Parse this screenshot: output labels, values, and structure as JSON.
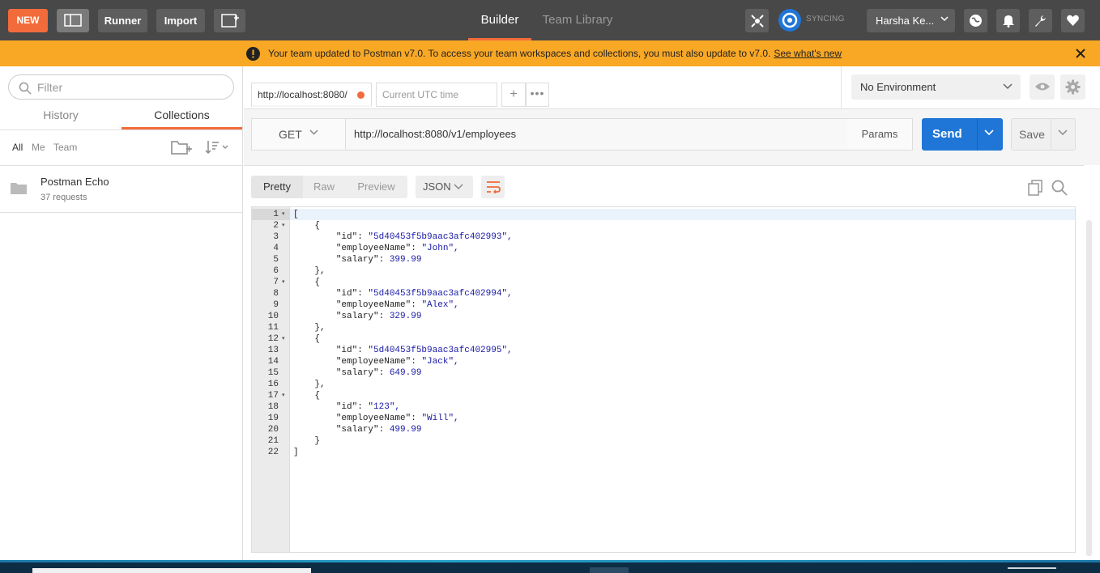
{
  "header": {
    "new_label": "NEW",
    "runner_label": "Runner",
    "import_label": "Import",
    "tab_builder": "Builder",
    "tab_team_library": "Team Library",
    "sync_status": "SYNCING",
    "user_name": "Harsha Ke...",
    "accent": "#f26b3a"
  },
  "banner": {
    "message": "Your team updated to Postman v7.0. To access your team workspaces and collections, you must also update to v7.0.",
    "link": "See what's new",
    "color": "#f9a825"
  },
  "sidebar": {
    "filter_placeholder": "Filter",
    "tabs": {
      "history": "History",
      "collections": "Collections"
    },
    "filters": {
      "all": "All",
      "me": "Me",
      "team": "Team"
    },
    "collections": [
      {
        "name": "Postman Echo",
        "count": "37 requests"
      }
    ]
  },
  "request": {
    "tab_label": "http://localhost:8080/",
    "tab2_placeholder": "Current UTC time",
    "environment": "No Environment",
    "method": "GET",
    "url": "http://localhost:8080/v1/employees",
    "params_label": "Params",
    "send_label": "Send",
    "save_label": "Save",
    "send_color": "#2076d6"
  },
  "response": {
    "view_tabs": [
      "Pretty",
      "Raw",
      "Preview"
    ],
    "format": "JSON",
    "lines": [
      "[",
      "    {",
      "        \"id\": \"5d40453f5b9aac3afc402993\",",
      "        \"employeeName\": \"John\",",
      "        \"salary\": 399.99",
      "    },",
      "    {",
      "        \"id\": \"5d40453f5b9aac3afc402994\",",
      "        \"employeeName\": \"Alex\",",
      "        \"salary\": 329.99",
      "    },",
      "    {",
      "        \"id\": \"5d40453f5b9aac3afc402995\",",
      "        \"employeeName\": \"Jack\",",
      "        \"salary\": 649.99",
      "    },",
      "    {",
      "        \"id\": \"123\",",
      "        \"employeeName\": \"Will\",",
      "        \"salary\": 499.99",
      "    }",
      "]"
    ],
    "fold_lines": [
      1,
      2,
      7,
      12,
      17
    ]
  }
}
